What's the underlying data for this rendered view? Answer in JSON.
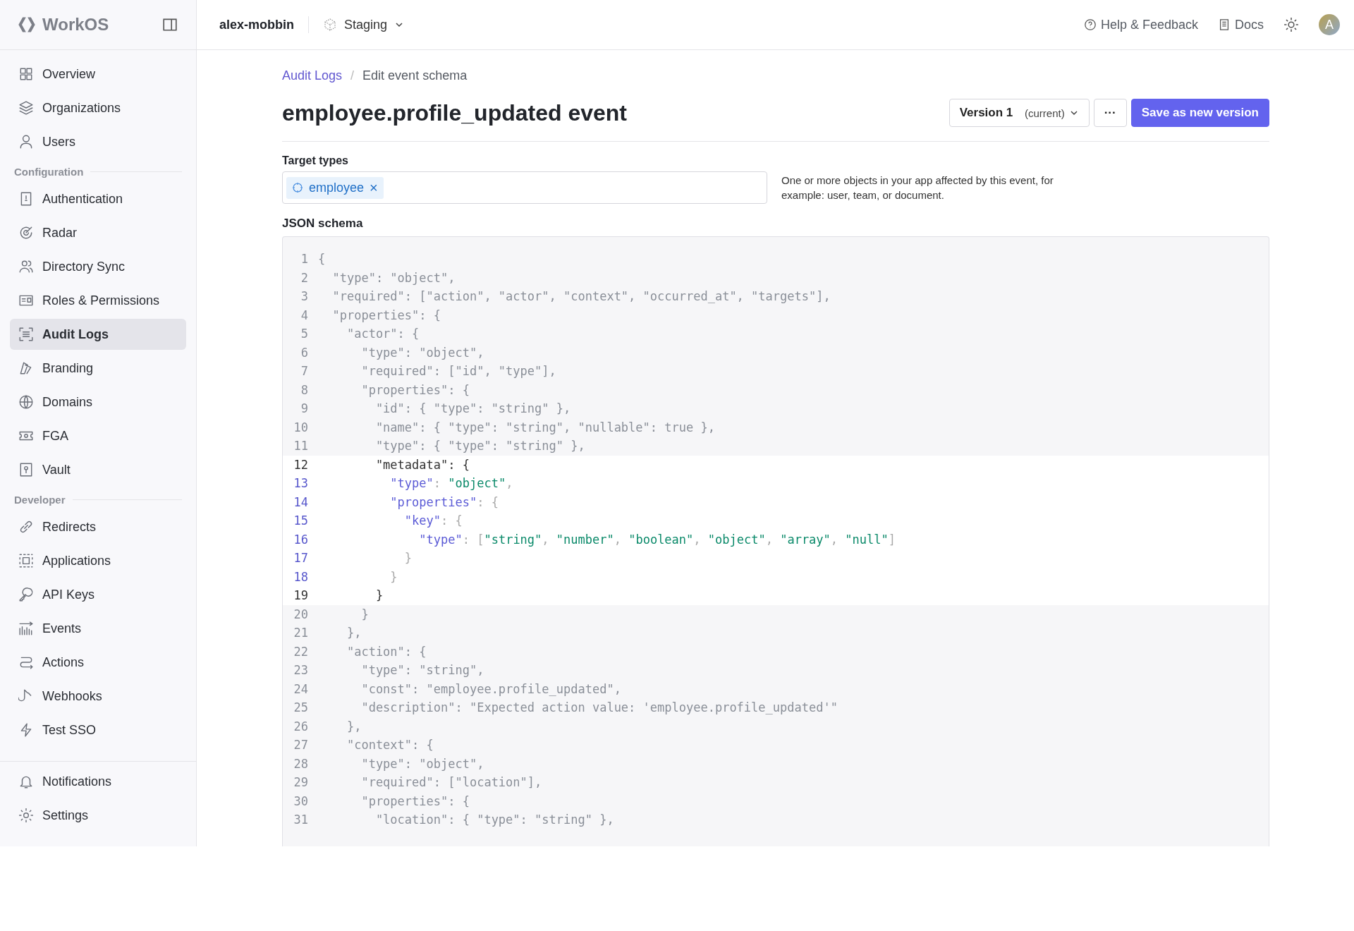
{
  "brand": {
    "name": "WorkOS"
  },
  "topbar": {
    "workspace": "alex-mobbin",
    "environment": "Staging",
    "links": [
      "Help & Feedback",
      "Docs"
    ],
    "avatar": "A"
  },
  "sidebar": {
    "groups": [
      {
        "items": [
          {
            "label": "Overview",
            "selected": false
          },
          {
            "label": "Organizations",
            "selected": false
          },
          {
            "label": "Users",
            "selected": false
          }
        ]
      },
      {
        "heading": "Configuration",
        "items": [
          {
            "label": "Authentication",
            "selected": false
          },
          {
            "label": "Radar",
            "selected": false
          },
          {
            "label": "Directory Sync",
            "selected": false
          },
          {
            "label": "Roles & Permissions",
            "selected": false
          },
          {
            "label": "Audit Logs",
            "selected": true
          },
          {
            "label": "Branding",
            "selected": false
          },
          {
            "label": "Domains",
            "selected": false
          },
          {
            "label": "FGA",
            "selected": false
          },
          {
            "label": "Vault",
            "selected": false
          }
        ]
      },
      {
        "heading": "Developer",
        "items": [
          {
            "label": "Redirects",
            "selected": false
          },
          {
            "label": "Applications",
            "selected": false
          },
          {
            "label": "API Keys",
            "selected": false
          },
          {
            "label": "Events",
            "selected": false
          },
          {
            "label": "Actions",
            "selected": false
          },
          {
            "label": "Webhooks",
            "selected": false
          },
          {
            "label": "Test SSO",
            "selected": false
          }
        ]
      }
    ],
    "footer_items": [
      {
        "label": "Notifications",
        "selected": false
      },
      {
        "label": "Settings",
        "selected": false
      }
    ]
  },
  "breadcrumb": {
    "link": "Audit Logs",
    "separator": "/",
    "current": "Edit event schema"
  },
  "page": {
    "title": "employee.profile_updated event",
    "version": {
      "label": "Version 1",
      "note": "(current)"
    },
    "more": "···",
    "save": "Save as new version"
  },
  "target_types": {
    "label": "Target types",
    "tags": [
      "employee"
    ],
    "remove": "×",
    "help": "One or more objects in your app affected by this event, for example: user, team, or document."
  },
  "schema": {
    "label": "JSON schema",
    "lines": [
      {
        "n": "1",
        "kind": "locked",
        "text": "{"
      },
      {
        "n": "2",
        "kind": "locked",
        "text": "  \"type\": \"object\","
      },
      {
        "n": "3",
        "kind": "locked",
        "text": "  \"required\": [\"action\", \"actor\", \"context\", \"occurred_at\", \"targets\"],"
      },
      {
        "n": "4",
        "kind": "locked",
        "text": "  \"properties\": {"
      },
      {
        "n": "5",
        "kind": "locked",
        "text": "    \"actor\": {"
      },
      {
        "n": "6",
        "kind": "locked",
        "text": "      \"type\": \"object\","
      },
      {
        "n": "7",
        "kind": "locked",
        "text": "      \"required\": [\"id\", \"type\"],"
      },
      {
        "n": "8",
        "kind": "locked",
        "text": "      \"properties\": {"
      },
      {
        "n": "9",
        "kind": "locked",
        "text": "        \"id\": { \"type\": \"string\" },"
      },
      {
        "n": "10",
        "kind": "locked",
        "text": "        \"name\": { \"type\": \"string\", \"nullable\": true },"
      },
      {
        "n": "11",
        "kind": "locked",
        "text": "        \"type\": { \"type\": \"string\" },"
      },
      {
        "n": "12",
        "kind": "plain",
        "text": "        \"metadata\": {"
      },
      {
        "n": "13",
        "kind": "highlighted",
        "text": "          \"type\": \"object\","
      },
      {
        "n": "14",
        "kind": "highlighted",
        "text": "          \"properties\": {"
      },
      {
        "n": "15",
        "kind": "highlighted",
        "text": "            \"key\": {"
      },
      {
        "n": "16",
        "kind": "highlighted",
        "text": "              \"type\": [\"string\", \"number\", \"boolean\", \"object\", \"array\", \"null\"]"
      },
      {
        "n": "17",
        "kind": "highlighted",
        "text": "            }"
      },
      {
        "n": "18",
        "kind": "highlighted",
        "text": "          }"
      },
      {
        "n": "19",
        "kind": "plain",
        "text": "        }"
      },
      {
        "n": "20",
        "kind": "locked",
        "text": "      }"
      },
      {
        "n": "21",
        "kind": "locked",
        "text": "    },"
      },
      {
        "n": "22",
        "kind": "locked",
        "text": "    \"action\": {"
      },
      {
        "n": "23",
        "kind": "locked",
        "text": "      \"type\": \"string\","
      },
      {
        "n": "24",
        "kind": "locked",
        "text": "      \"const\": \"employee.profile_updated\","
      },
      {
        "n": "25",
        "kind": "locked",
        "text": "      \"description\": \"Expected action value: 'employee.profile_updated'\""
      },
      {
        "n": "26",
        "kind": "locked",
        "text": "    },"
      },
      {
        "n": "27",
        "kind": "locked",
        "text": "    \"context\": {"
      },
      {
        "n": "28",
        "kind": "locked",
        "text": "      \"type\": \"object\","
      },
      {
        "n": "29",
        "kind": "locked",
        "text": "      \"required\": [\"location\"],"
      },
      {
        "n": "30",
        "kind": "locked",
        "text": "      \"properties\": {"
      },
      {
        "n": "31",
        "kind": "locked",
        "text": "        \"location\": { \"type\": \"string\" },"
      }
    ]
  }
}
